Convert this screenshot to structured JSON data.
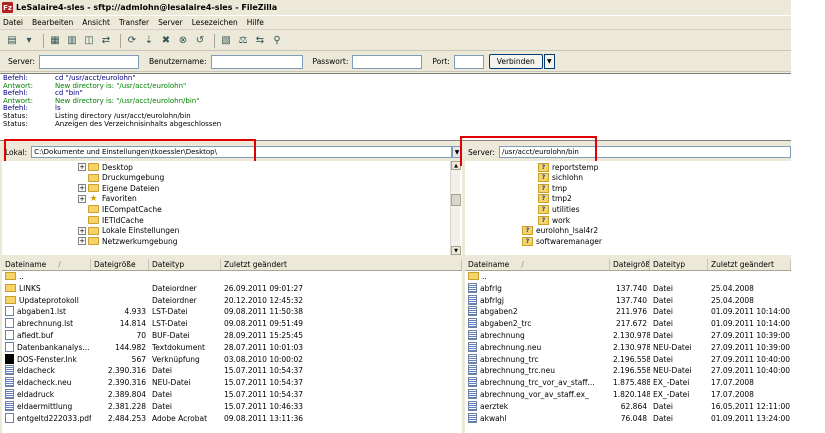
{
  "window": {
    "title": "LeSalaire4-sles - sftp://admlohn@lesalaire4-sles - FileZilla",
    "app_icon": "Fz"
  },
  "menu": [
    "Datei",
    "Bearbeiten",
    "Ansicht",
    "Transfer",
    "Server",
    "Lesezeichen",
    "Hilfe"
  ],
  "toolbar_icons": [
    "site-manager-icon",
    "dropdown-icon",
    "sep",
    "toggle-log-icon",
    "toggle-local-tree-icon",
    "toggle-remote-tree-icon",
    "toggle-queue-icon",
    "sep",
    "refresh-icon",
    "process-queue-icon",
    "cancel-icon",
    "disconnect-icon",
    "reconnect-icon",
    "sep",
    "filter-icon",
    "compare-icon",
    "sync-browse-icon",
    "search-icon"
  ],
  "quickconnect": {
    "server_label": "Server:",
    "server_value": "",
    "user_label": "Benutzername:",
    "user_value": "",
    "pass_label": "Passwort:",
    "pass_value": "",
    "port_label": "Port:",
    "port_value": "",
    "connect_label": "Verbinden",
    "arrow": "▼"
  },
  "log": [
    {
      "label": "Befehl:",
      "text": "cd \"/usr/acct/eurolohn\"",
      "color": "navy"
    },
    {
      "label": "Antwort:",
      "text": "New directory is: \"/usr/acct/eurolohn\"",
      "color": "green"
    },
    {
      "label": "Befehl:",
      "text": "cd \"bin\"",
      "color": "navy"
    },
    {
      "label": "Antwort:",
      "text": "New directory is: \"/usr/acct/eurolohn/bin\"",
      "color": "green"
    },
    {
      "label": "Befehl:",
      "text": "ls",
      "color": "navy"
    },
    {
      "label": "Status:",
      "text": "Listing directory /usr/acct/eurolohn/bin",
      "color": "black"
    },
    {
      "label": "Status:",
      "text": "Anzeigen des Verzeichnisinhalts abgeschlossen",
      "color": "black"
    }
  ],
  "local": {
    "path_label": "Lokal:",
    "path": "C:\\Dokumente und Einstellungen\\tkoessler\\Desktop\\",
    "tree": [
      {
        "name": "Desktop",
        "exp": "+",
        "icon": "folder"
      },
      {
        "name": "Druckumgebung",
        "exp": "",
        "icon": "folder"
      },
      {
        "name": "Eigene Dateien",
        "exp": "+",
        "icon": "folder"
      },
      {
        "name": "Favoriten",
        "exp": "+",
        "icon": "star"
      },
      {
        "name": "IECompatCache",
        "exp": "",
        "icon": "folder"
      },
      {
        "name": "IETldCache",
        "exp": "",
        "icon": "folder"
      },
      {
        "name": "Lokale Einstellungen",
        "exp": "+",
        "icon": "folder"
      },
      {
        "name": "Netzwerkumgebung",
        "exp": "+",
        "icon": "folder"
      }
    ],
    "columns": [
      "Dateiname",
      "Dateigröße",
      "Dateityp",
      "Zuletzt geändert"
    ],
    "sort_arrow": "/",
    "rows": [
      {
        "name": "..",
        "size": "",
        "type": "",
        "modified": "",
        "icon": "folder-i"
      },
      {
        "name": "LINKS",
        "size": "",
        "type": "Dateiordner",
        "modified": "26.09.2011 09:01:27",
        "icon": "folder-i"
      },
      {
        "name": "Updateprotokoll",
        "size": "",
        "type": "Dateiordner",
        "modified": "20.12.2010 12:45:32",
        "icon": "folder-i"
      },
      {
        "name": "abgaben1.lst",
        "size": "4.933",
        "type": "LST-Datei",
        "modified": "09.08.2011 11:50:38",
        "icon": "txt"
      },
      {
        "name": "abrechnung.lst",
        "size": "14.814",
        "type": "LST-Datei",
        "modified": "09.08.2011 09:51:49",
        "icon": "txt"
      },
      {
        "name": "afiedt.buf",
        "size": "70",
        "type": "BUF-Datei",
        "modified": "28.09.2011 15:25:45",
        "icon": "txt"
      },
      {
        "name": "Datenbankanalys...",
        "size": "144.982",
        "type": "Textdokument",
        "modified": "28.07.2011 10:01:03",
        "icon": "txt"
      },
      {
        "name": "DOS-Fenster.lnk",
        "size": "567",
        "type": "Verknüpfung",
        "modified": "03.08.2010 10:00:02",
        "icon": "cmd"
      },
      {
        "name": "eldacheck",
        "size": "2.390.316",
        "type": "Datei",
        "modified": "15.07.2011 10:54:37",
        "icon": "bin"
      },
      {
        "name": "eldacheck.neu",
        "size": "2.390.316",
        "type": "NEU-Datei",
        "modified": "15.07.2011 10:54:37",
        "icon": "bin"
      },
      {
        "name": "eldadruck",
        "size": "2.389.804",
        "type": "Datei",
        "modified": "15.07.2011 10:54:37",
        "icon": "bin"
      },
      {
        "name": "eldaermittlung",
        "size": "2.381.228",
        "type": "Datei",
        "modified": "15.07.2011 10:46:33",
        "icon": "bin"
      },
      {
        "name": "entgeltd222033.pdf",
        "size": "2.484.253",
        "type": "Adobe Acrobat",
        "modified": "09.08.2011 13:11:36",
        "icon": "txt"
      }
    ]
  },
  "remote": {
    "path_label": "Server:",
    "path": "/usr/acct/eurolohn/bin",
    "tree": [
      {
        "name": "reportstemp",
        "indent": 2
      },
      {
        "name": "sichlohn",
        "indent": 2
      },
      {
        "name": "tmp",
        "indent": 2
      },
      {
        "name": "tmp2",
        "indent": 2
      },
      {
        "name": "utilities",
        "indent": 2
      },
      {
        "name": "work",
        "indent": 2
      },
      {
        "name": "eurolohn_lsal4r2",
        "indent": 1
      },
      {
        "name": "softwaremanager",
        "indent": 1
      }
    ],
    "columns": [
      "Dateiname",
      "Dateigröße",
      "Dateityp",
      "Zuletzt geändert"
    ],
    "sort_arrow": "/",
    "rows": [
      {
        "name": "..",
        "size": "",
        "type": "",
        "modified": "",
        "icon": "folder-i"
      },
      {
        "name": "abfrlg",
        "size": "137.740",
        "type": "Datei",
        "modified": "25.04.2008",
        "icon": "bin"
      },
      {
        "name": "abfrlgj",
        "size": "137.740",
        "type": "Datei",
        "modified": "25.04.2008",
        "icon": "bin"
      },
      {
        "name": "abgaben2",
        "size": "211.976",
        "type": "Datei",
        "modified": "01.09.2011 10:14:00",
        "icon": "bin"
      },
      {
        "name": "abgaben2_trc",
        "size": "217.672",
        "type": "Datei",
        "modified": "01.09.2011 10:14:00",
        "icon": "bin"
      },
      {
        "name": "abrechnung",
        "size": "2.130.978",
        "type": "Datei",
        "modified": "27.09.2011 10:39:00",
        "icon": "bin"
      },
      {
        "name": "abrechnung.neu",
        "size": "2.130.978",
        "type": "NEU-Datei",
        "modified": "27.09.2011 10:39:00",
        "icon": "bin"
      },
      {
        "name": "abrechnung_trc",
        "size": "2.196.558",
        "type": "Datei",
        "modified": "27.09.2011 10:40:00",
        "icon": "bin"
      },
      {
        "name": "abrechnung_trc.neu",
        "size": "2.196.558",
        "type": "NEU-Datei",
        "modified": "27.09.2011 10:40:00",
        "icon": "bin"
      },
      {
        "name": "abrechnung_trc_vor_av_staff...",
        "size": "1.875.488",
        "type": "EX_-Datei",
        "modified": "17.07.2008",
        "icon": "bin"
      },
      {
        "name": "abrechnung_vor_av_staff.ex_",
        "size": "1.820.148",
        "type": "EX_-Datei",
        "modified": "17.07.2008",
        "icon": "bin"
      },
      {
        "name": "aerztek",
        "size": "62.864",
        "type": "Datei",
        "modified": "16.05.2011 12:11:00",
        "icon": "bin"
      },
      {
        "name": "akwahl",
        "size": "76.048",
        "type": "Datei",
        "modified": "01.09.2011 13:24:00",
        "icon": "bin"
      }
    ]
  },
  "colors": {
    "highlight_box": "#e00000",
    "command": "#000080",
    "response": "#008000"
  }
}
